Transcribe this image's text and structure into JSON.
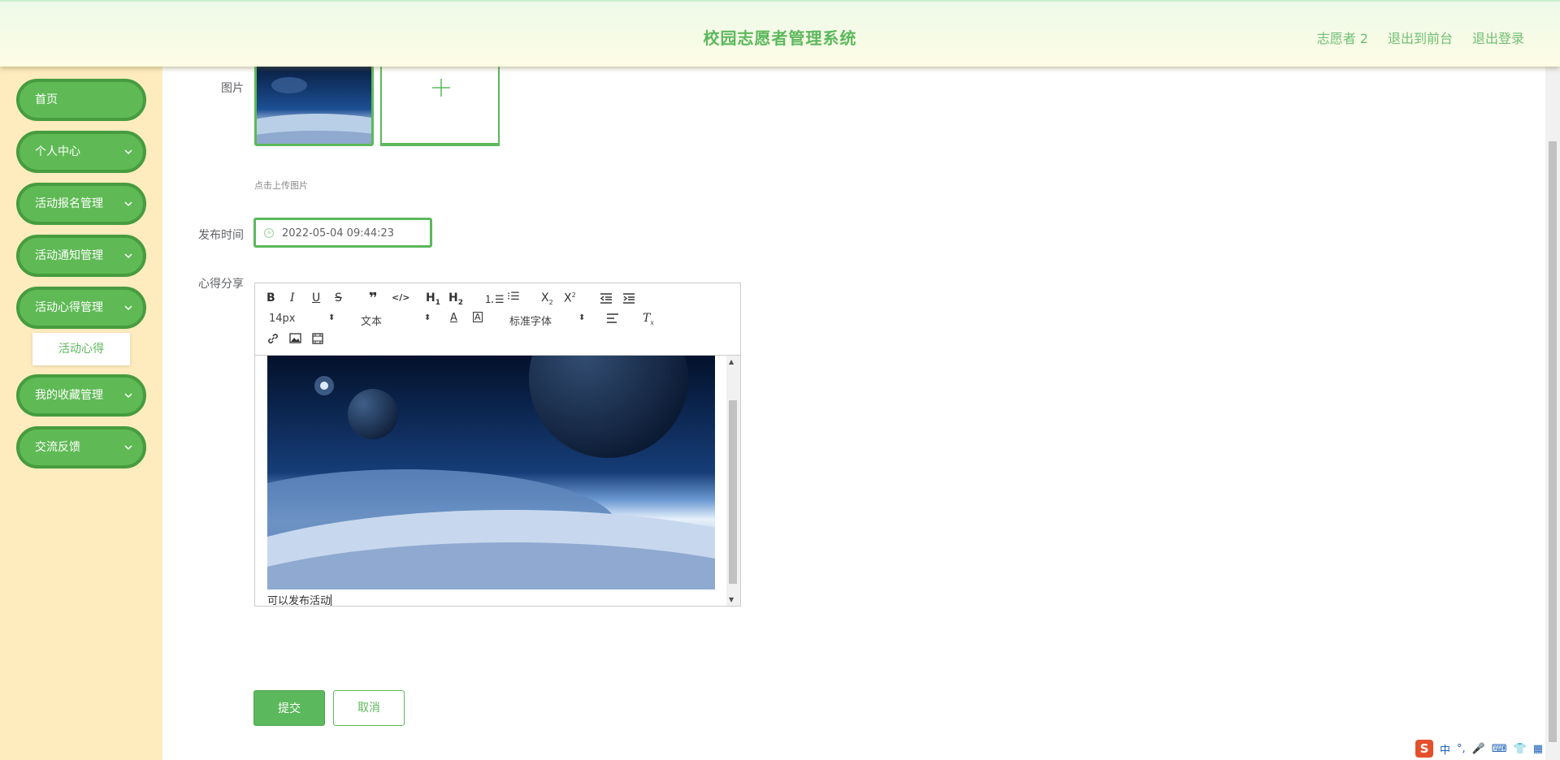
{
  "header": {
    "title": "校园志愿者管理系统",
    "user": "志愿者 2",
    "to_front": "退出到前台",
    "logout": "退出登录"
  },
  "sidebar": {
    "items": [
      {
        "label": "首页",
        "has_children": false
      },
      {
        "label": "个人中心",
        "has_children": true
      },
      {
        "label": "活动报名管理",
        "has_children": true
      },
      {
        "label": "活动通知管理",
        "has_children": true
      },
      {
        "label": "活动心得管理",
        "has_children": true,
        "expanded": true
      },
      {
        "label": "我的收藏管理",
        "has_children": true
      },
      {
        "label": "交流反馈",
        "has_children": true
      }
    ],
    "active_sub": "活动心得"
  },
  "form": {
    "image_label": "图片",
    "upload_tip": "点击上传图片",
    "time_label": "发布时间",
    "time_value": "2022-05-04 09:44:23",
    "content_label": "心得分享",
    "editor_text": "可以发布活动",
    "submit": "提交",
    "cancel": "取消"
  },
  "editor_toolbar": {
    "font_size": "14px",
    "paragraph": "文本",
    "font_family": "标准字体",
    "buttons": [
      "bold-icon",
      "italic-icon",
      "underline-icon",
      "strike-icon",
      "quote-icon",
      "code-icon",
      "h1-icon",
      "h2-icon",
      "ordered-list-icon",
      "bullet-list-icon",
      "subscript-icon",
      "superscript-icon",
      "outdent-icon",
      "indent-icon",
      "font-color-icon",
      "background-color-icon",
      "align-icon",
      "clear-format-icon",
      "link-icon",
      "image-icon",
      "video-icon"
    ]
  },
  "ime": {
    "lang": "中"
  },
  "colors": {
    "accent": "#5cb85c",
    "sidebar_bg": "#feecbe",
    "nav_bg": "#5fba55"
  }
}
